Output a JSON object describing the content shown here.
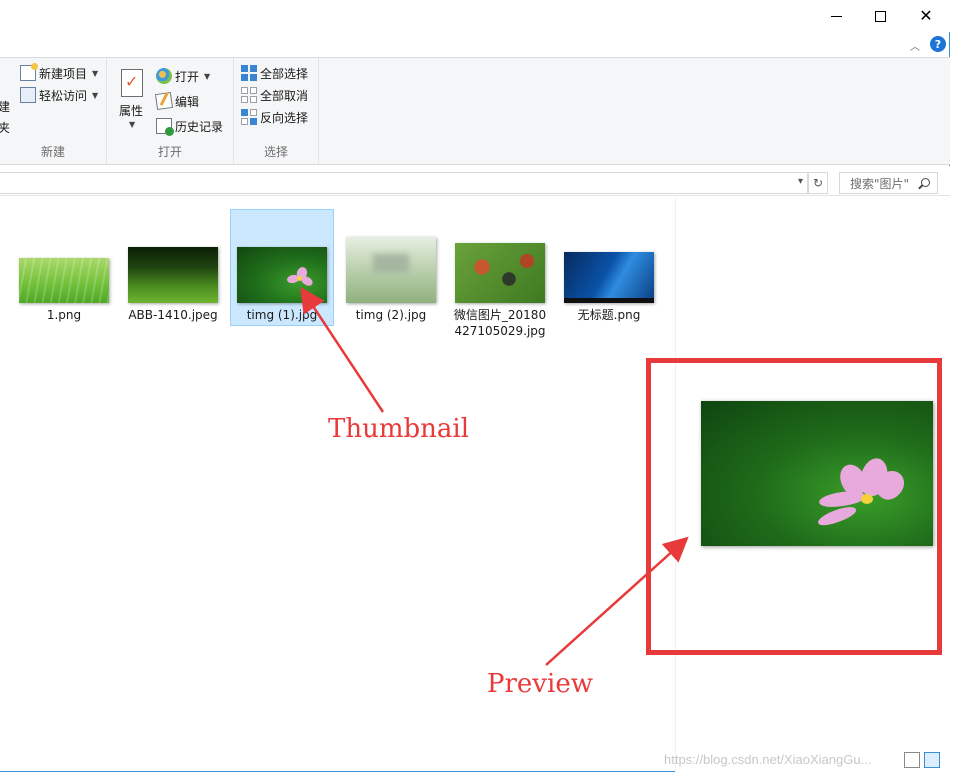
{
  "ribbon": {
    "new_group": {
      "label": "新建",
      "new_item": "新建项目",
      "easy_access": "轻松访问",
      "partial_top": "建",
      "partial_bottom": "夹"
    },
    "open_group": {
      "label": "打开",
      "properties": "属性",
      "open": "打开",
      "edit": "编辑",
      "history": "历史记录"
    },
    "select_group": {
      "label": "选择",
      "select_all": "全部选择",
      "select_none": "全部取消",
      "invert": "反向选择"
    }
  },
  "search": {
    "placeholder": "搜索\"图片\""
  },
  "files": [
    {
      "name": "1.png"
    },
    {
      "name": "ABB-1410.jpeg"
    },
    {
      "name": "timg (1).jpg",
      "selected": true
    },
    {
      "name": "timg (2).jpg"
    },
    {
      "name": "微信图片_20180427105029.jpg"
    },
    {
      "name": "无标题.png"
    }
  ],
  "annotations": {
    "thumbnail": "Thumbnail",
    "preview": "Preview",
    "color": "#e83a3a"
  },
  "watermark": "https://blog.csdn.net/XiaoXiangGu..."
}
